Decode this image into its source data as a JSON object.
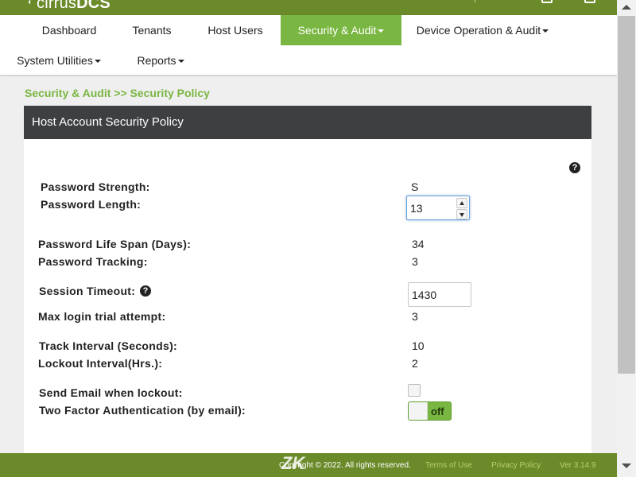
{
  "brand": {
    "name_light": "cirrus",
    "name_bold": "DCS"
  },
  "nav": {
    "row1": [
      {
        "label": "Dashboard",
        "active": false,
        "dropdown": false
      },
      {
        "label": "Tenants",
        "active": false,
        "dropdown": false
      },
      {
        "label": "Host Users",
        "active": false,
        "dropdown": false
      },
      {
        "label": "Security & Audit",
        "active": true,
        "dropdown": true
      },
      {
        "label": "Device Operation & Audit",
        "active": false,
        "dropdown": true
      }
    ],
    "row2": [
      {
        "label": "System Utilities",
        "active": false,
        "dropdown": true
      },
      {
        "label": "Reports",
        "active": false,
        "dropdown": true
      }
    ]
  },
  "breadcrumb": "Security & Audit >> Security Policy",
  "panel": {
    "title": "Host Account Security Policy",
    "help_icon": "?"
  },
  "policy": {
    "password_strength": {
      "label": "Password Strength:",
      "value": "S"
    },
    "password_length": {
      "label": "Password Length:",
      "value": "13"
    },
    "password_life_span": {
      "label": "Password Life Span (Days):",
      "value": "34"
    },
    "password_tracking": {
      "label": "Password Tracking:",
      "value": "3"
    },
    "session_timeout": {
      "label": "Session Timeout:",
      "value": "1430",
      "help_icon": "?"
    },
    "max_login_trial": {
      "label": "Max login trial attempt:",
      "value": "3"
    },
    "track_interval": {
      "label": "Track Interval (Seconds):",
      "value": "10"
    },
    "lockout_interval": {
      "label": "Lockout Interval(Hrs.):",
      "value": "2"
    },
    "send_email_lockout": {
      "label": "Send Email when lockout:",
      "checked": false
    },
    "two_factor_auth": {
      "label": "Two Factor Authentication (by email):",
      "state": "off"
    }
  },
  "footer": {
    "copyright": "Copyright © 2022. All rights reserved.",
    "terms": "Terms of Use",
    "privacy": "Privacy Policy",
    "version": "Ver 3.14.9"
  },
  "colors": {
    "brand_green": "#6b8a2a",
    "accent_green": "#7ab642",
    "panel_header": "#3d3f41"
  }
}
